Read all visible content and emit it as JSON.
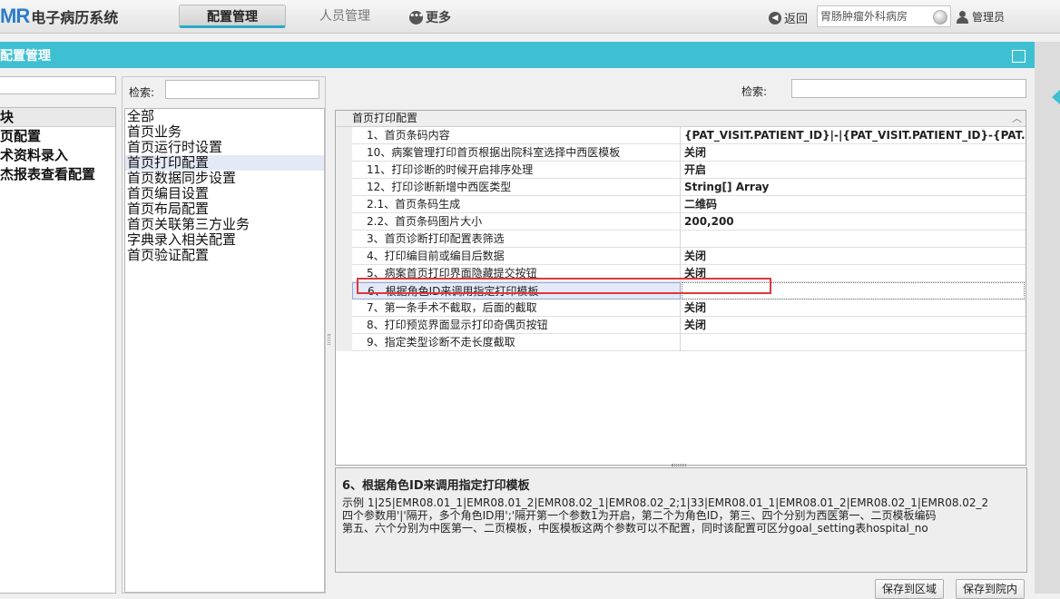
{
  "app": {
    "logo_mark": "MR",
    "title": "电子病历系统"
  },
  "nav": {
    "active_tab": "配置管理",
    "people_tab": "人员管理",
    "more": "更多",
    "more_icon": "ellipsis-circle-icon"
  },
  "header": {
    "back": "返回",
    "ward": "胃肠肿瘤外科病房",
    "user": "管理员"
  },
  "panel": {
    "title": "配置管理"
  },
  "left": {
    "items": [
      {
        "label": "块",
        "header": true
      },
      {
        "label": "页配置"
      },
      {
        "label": "术资料录入"
      },
      {
        "label": "杰报表查看配置"
      }
    ]
  },
  "middle": {
    "search_label": "检索:",
    "search_value": "",
    "items": [
      {
        "label": "全部"
      },
      {
        "label": "首页业务"
      },
      {
        "label": "首页运行时设置"
      },
      {
        "label": "首页打印配置",
        "selected": true
      },
      {
        "label": "首页数据同步设置"
      },
      {
        "label": "首页编目设置"
      },
      {
        "label": "首页布局配置"
      },
      {
        "label": "首页关联第三方业务"
      },
      {
        "label": "字典录入相关配置"
      },
      {
        "label": "首页验证配置"
      }
    ]
  },
  "right": {
    "search_label": "检索:",
    "search_value": "",
    "grid": {
      "category": "首页打印配置",
      "rows": [
        {
          "name": "1、首页条码内容",
          "value": "{PAT_VISIT.PATIENT_ID}|-|{PAT_VISIT.PATIENT_ID}-{PAT..."
        },
        {
          "name": "10、病案管理打印首页根据出院科室选择中西医模板",
          "value": "关闭"
        },
        {
          "name": "11、打印诊断的时候开启排序处理",
          "value": "开启"
        },
        {
          "name": "12、打印诊断新增中西医类型",
          "value": "String[] Array"
        },
        {
          "name": "2.1、首页条码生成",
          "value": "二维码"
        },
        {
          "name": "2.2、首页条码图片大小",
          "value": "200,200"
        },
        {
          "name": "3、首页诊断打印配置表筛选",
          "value": ""
        },
        {
          "name": "4、打印编目前或编目后数据",
          "value": "关闭"
        },
        {
          "name": "5、病案首页打印界面隐藏提交按钮",
          "value": "关闭"
        },
        {
          "name": "6、根据角色ID来调用指定打印模板",
          "value": "",
          "selected": true
        },
        {
          "name": "7、第一条手术不截取，后面的截取",
          "value": "关闭"
        },
        {
          "name": "8、打印预览界面显示打印奇偶页按钮",
          "value": "关闭"
        },
        {
          "name": "9、指定类型诊断不走长度截取",
          "value": ""
        }
      ]
    },
    "description": {
      "title": "6、根据角色ID来调用指定打印模板",
      "lines": [
        "示例 1|25|EMR08.01_1|EMR08.01_2|EMR08.02_1|EMR08.02_2;1|33|EMR08.01_1|EMR08.01_2|EMR08.02_1|EMR08.02_2",
        "四个参数用'|'隔开，多个角色ID用';'隔开第一个参数1为开启，第二个为角色ID，第三、四个分别为西医第一、二页模板编码",
        "第五、六个分别为中医第一、二页模板，中医模板这两个参数可以不配置，同时该配置可区分goal_setting表hospital_no"
      ]
    },
    "buttons": {
      "save_region": "保存到区域",
      "save_hospital": "保存到院内"
    }
  },
  "colors": {
    "accent": "#3fc0d2",
    "highlight": "#e0373c",
    "selection": "#e3e9f6"
  }
}
